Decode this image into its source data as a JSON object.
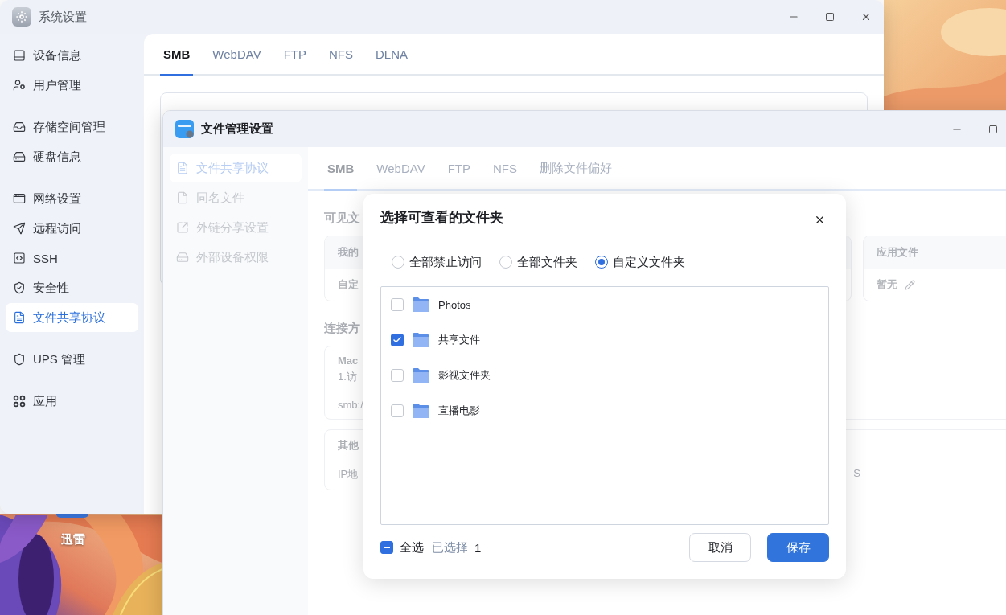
{
  "desktop": {
    "icons": [
      {
        "label": "迅雷"
      }
    ]
  },
  "system_settings": {
    "title": "系统设置",
    "sidebar": {
      "groups": [
        {
          "items": [
            {
              "label": "设备信息",
              "selected": false
            },
            {
              "label": "用户管理",
              "selected": false
            }
          ]
        },
        {
          "items": [
            {
              "label": "存储空间管理",
              "selected": false
            },
            {
              "label": "硬盘信息",
              "selected": false
            }
          ]
        },
        {
          "items": [
            {
              "label": "网络设置",
              "selected": false
            },
            {
              "label": "远程访问",
              "selected": false
            },
            {
              "label": "SSH",
              "selected": false
            },
            {
              "label": "安全性",
              "selected": false
            },
            {
              "label": "文件共享协议",
              "selected": true
            }
          ]
        },
        {
          "items": [
            {
              "label": "UPS 管理",
              "selected": false
            }
          ]
        },
        {
          "items": [
            {
              "label": "应用",
              "selected": false
            }
          ]
        }
      ]
    },
    "tabs": [
      {
        "label": "SMB",
        "selected": true
      },
      {
        "label": "WebDAV",
        "selected": false
      },
      {
        "label": "FTP",
        "selected": false
      },
      {
        "label": "NFS",
        "selected": false
      },
      {
        "label": "DLNA",
        "selected": false
      }
    ]
  },
  "file_manager_settings": {
    "title": "文件管理设置",
    "sidebar": {
      "items": [
        {
          "label": "文件共享协议",
          "selected": true
        },
        {
          "label": "同名文件",
          "selected": false
        },
        {
          "label": "外链分享设置",
          "selected": false
        },
        {
          "label": "外部设备权限",
          "selected": false
        }
      ]
    },
    "tabs": [
      {
        "label": "SMB",
        "selected": true
      },
      {
        "label": "WebDAV",
        "selected": false
      },
      {
        "label": "FTP",
        "selected": false
      },
      {
        "label": "NFS",
        "selected": false
      },
      {
        "label": "删除文件偏好",
        "selected": false
      }
    ],
    "visible_files": {
      "heading": "可见文",
      "cards": [
        {
          "header": "我的",
          "value": "自定"
        },
        {
          "header": "应用文件",
          "value": "暂无",
          "editable": true
        }
      ]
    },
    "connection": {
      "heading": "连接方",
      "cards": [
        {
          "title": "Mac",
          "lines": [
            "1.访",
            "smb:/"
          ]
        },
        {
          "title": "其他",
          "lines": [
            "IP地"
          ],
          "tail": "S"
        }
      ]
    }
  },
  "dialog": {
    "title": "选择可查看的文件夹",
    "options": [
      {
        "label": "全部禁止访问",
        "selected": false
      },
      {
        "label": "全部文件夹",
        "selected": false
      },
      {
        "label": "自定义文件夹",
        "selected": true
      }
    ],
    "folders": [
      {
        "name": "Photos",
        "checked": false
      },
      {
        "name": "共享文件",
        "checked": true
      },
      {
        "name": "影视文件夹",
        "checked": false
      },
      {
        "name": "直播电影",
        "checked": false
      }
    ],
    "select_all": {
      "label": "全选",
      "indeterminate": true
    },
    "selected_label": "已选择",
    "selected_count": "1",
    "buttons": [
      {
        "label": "取消",
        "kind": "secondary"
      },
      {
        "label": "保存",
        "kind": "primary"
      }
    ]
  }
}
